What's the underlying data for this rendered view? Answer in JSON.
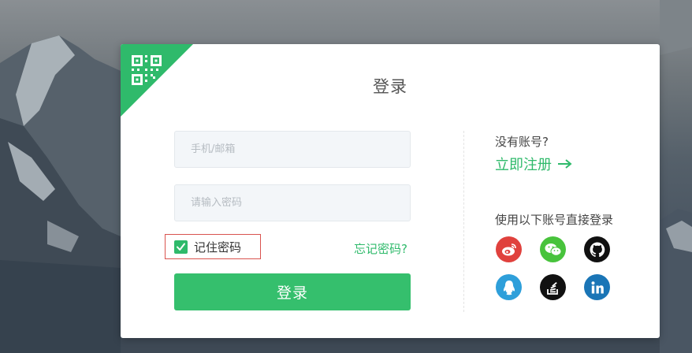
{
  "title": "登录",
  "form": {
    "account_placeholder": "手机/邮箱",
    "password_placeholder": "请输入密码",
    "remember_label": "记住密码",
    "remember_checked": true,
    "forgot_link": "忘记密码?",
    "submit_label": "登录"
  },
  "register": {
    "prompt": "没有账号?",
    "link_label": "立即注册"
  },
  "social": {
    "title": "使用以下账号直接登录",
    "providers": [
      "weibo-icon",
      "wechat-icon",
      "github-icon",
      "qq-icon",
      "stackoverflow-icon",
      "linkedin-icon"
    ]
  },
  "colors": {
    "accent": "#35bf6d",
    "highlight_border": "#d9534f"
  }
}
